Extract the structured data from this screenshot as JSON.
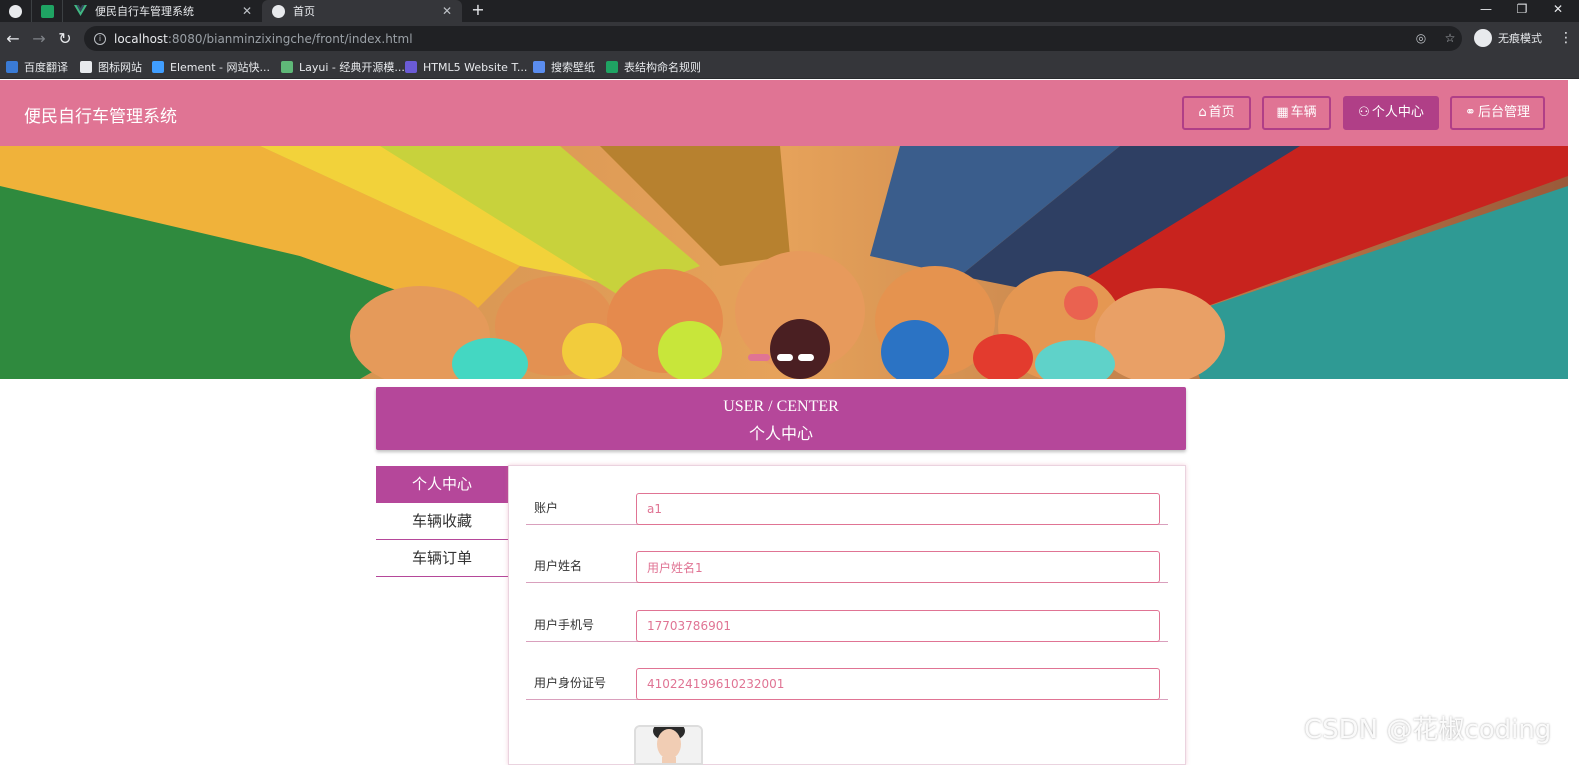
{
  "browser": {
    "tabs": [
      {
        "title": "便民自行车管理系统",
        "close": "✕"
      },
      {
        "title": "首页",
        "close": "✕"
      }
    ],
    "new_tab": "+",
    "url_host": "localhost",
    "url_rest": ":8080/bianminzixingche/front/index.html",
    "incognito_label": "无痕模式",
    "bookmarks": [
      "百度翻译",
      "图标网站",
      "Element - 网站快...",
      "Layui - 经典开源模...",
      "HTML5 Website T...",
      "搜索壁纸",
      "表结构命名规则"
    ]
  },
  "header": {
    "site_title": "便民自行车管理系统",
    "nav": [
      {
        "label": "首页",
        "icon": "home-icon",
        "glyph": "⌂"
      },
      {
        "label": "车辆",
        "icon": "grid-icon",
        "glyph": "▦"
      },
      {
        "label": "个人中心",
        "icon": "user-icon",
        "glyph": "⚇"
      },
      {
        "label": "后台管理",
        "icon": "link-icon",
        "glyph": "⚭"
      }
    ]
  },
  "banner": {
    "slides": 3,
    "active_slide": 0
  },
  "section_head": {
    "en": "USER / CENTER",
    "cn": "个人中心"
  },
  "side_menu": [
    "个人中心",
    "车辆收藏",
    "车辆订单"
  ],
  "form": {
    "fields": [
      {
        "label": "账户",
        "value": "a1"
      },
      {
        "label": "用户姓名",
        "value": "用户姓名1"
      },
      {
        "label": "用户手机号",
        "value": "17703786901"
      },
      {
        "label": "用户身份证号",
        "value": "410224199610232001"
      }
    ]
  },
  "watermark": "CSDN @花椒coding",
  "colors": {
    "header_pink": "#e07494",
    "accent_purple": "#b5479a",
    "nav_border": "#b03f87"
  }
}
